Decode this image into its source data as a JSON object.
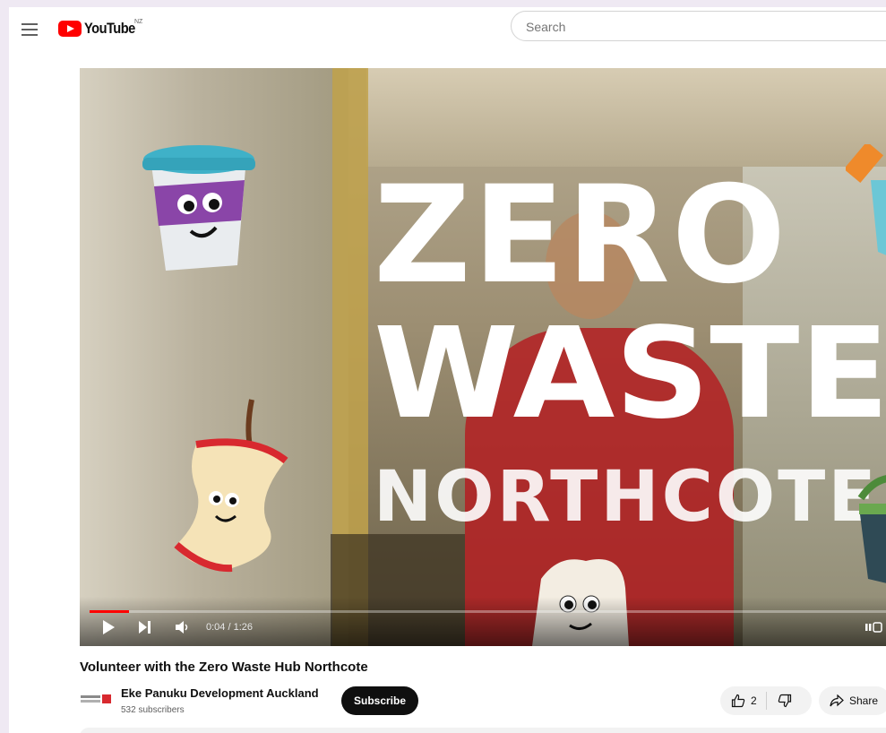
{
  "header": {
    "logo_text": "YouTube",
    "country_code": "NZ",
    "search_placeholder": "Search"
  },
  "video": {
    "overlay_line1": "ZERO",
    "overlay_line2": "WASTE",
    "overlay_line3": "NORTHCOTE",
    "time_display": "0:04 / 1:26",
    "progress_fraction": 0.05
  },
  "info": {
    "title": "Volunteer with the Zero Waste Hub Northcote",
    "channel_name": "Eke Panuku Development Auckland",
    "subscriber_count": "532 subscribers",
    "subscribe_label": "Subscribe",
    "like_count": "2",
    "share_label": "Share"
  },
  "colors": {
    "brand_red": "#ff0000",
    "subscribe_bg": "#0f0f0f"
  }
}
